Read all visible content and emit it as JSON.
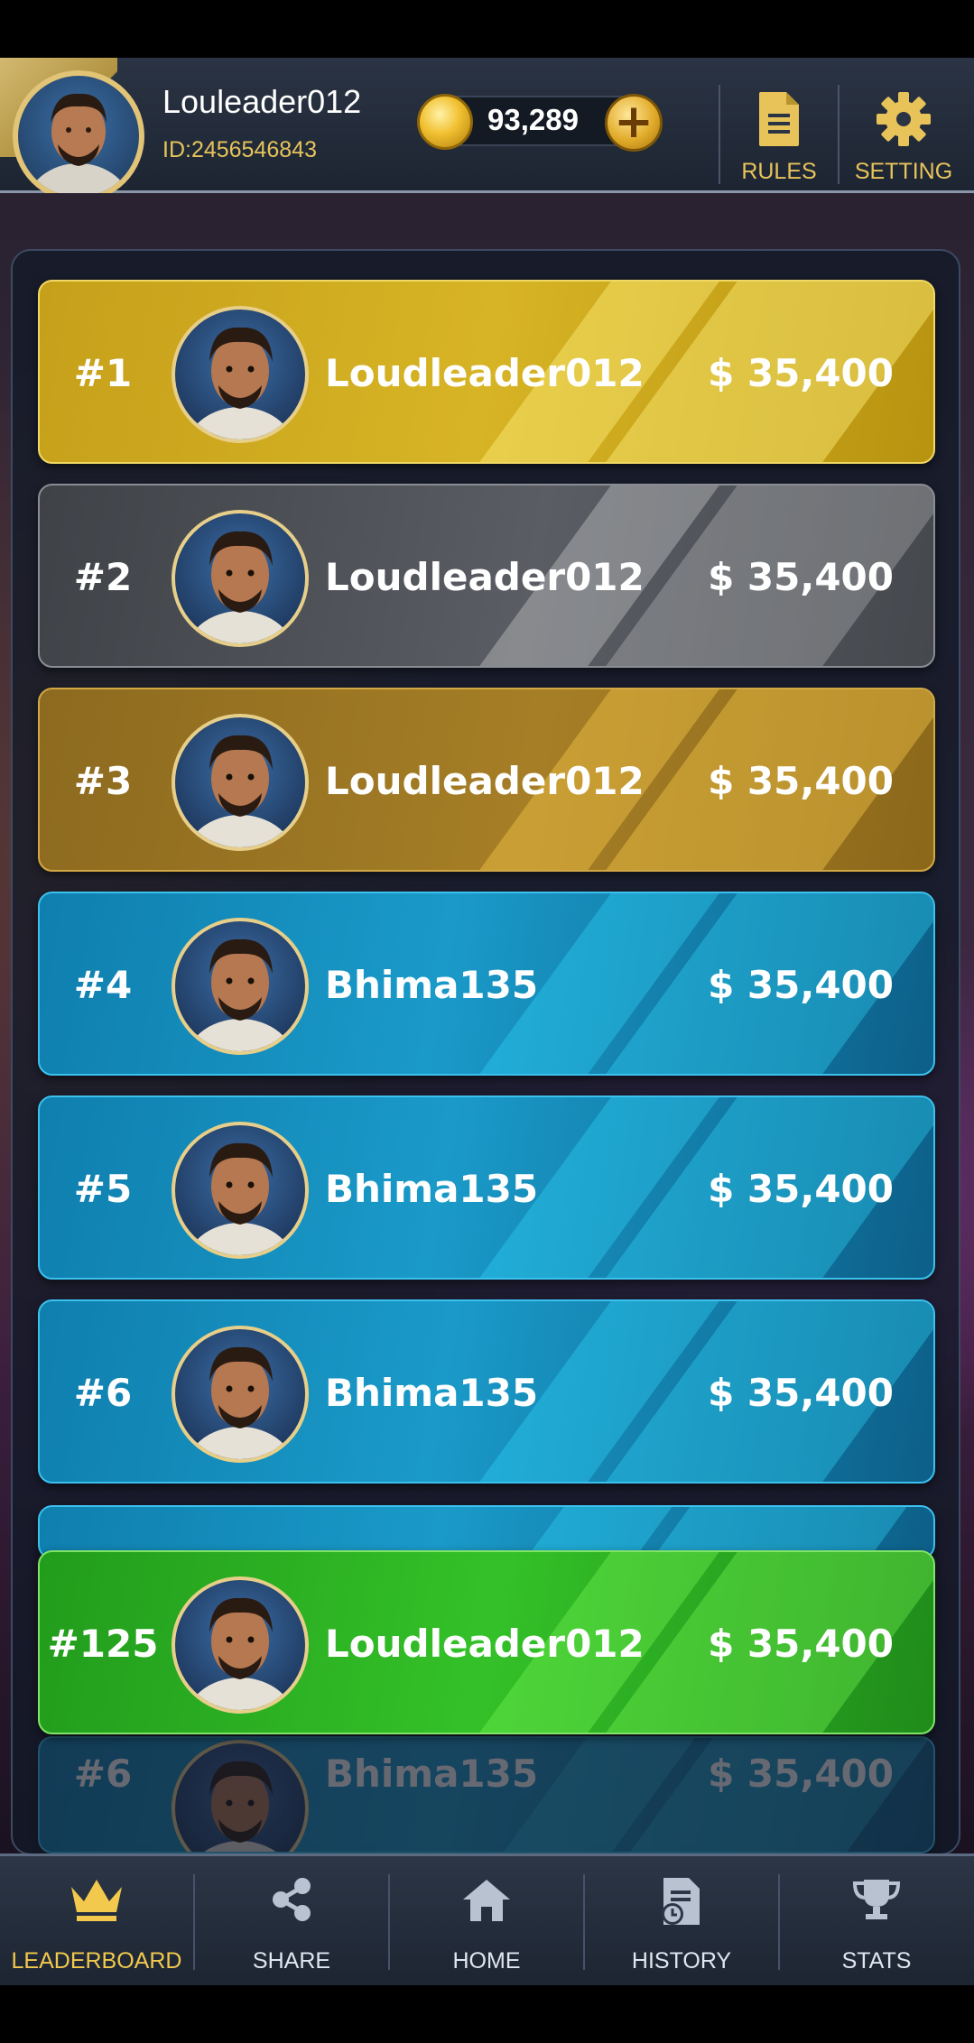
{
  "header": {
    "username": "Louleader012",
    "user_id": "ID:2456546843",
    "coins": "93,289",
    "add_coins_label": "+",
    "rules_label": "RULES",
    "setting_label": "SETTING"
  },
  "leaderboard": {
    "rows": [
      {
        "rank": "#1",
        "name": "Loudleader012",
        "amount": "$ 35,400",
        "tier": "gold"
      },
      {
        "rank": "#2",
        "name": "Loudleader012",
        "amount": "$ 35,400",
        "tier": "silver"
      },
      {
        "rank": "#3",
        "name": "Loudleader012",
        "amount": "$ 35,400",
        "tier": "bronze"
      },
      {
        "rank": "#4",
        "name": "Bhima135",
        "amount": "$ 35,400",
        "tier": "blue"
      },
      {
        "rank": "#5",
        "name": "Bhima135",
        "amount": "$ 35,400",
        "tier": "blue"
      },
      {
        "rank": "#6",
        "name": "Bhima135",
        "amount": "$ 35,400",
        "tier": "blue"
      }
    ],
    "current_user": {
      "rank": "#125",
      "name": "Loudleader012",
      "amount": "$ 35,400",
      "tier": "green"
    },
    "faded_row": {
      "rank": "#6",
      "name": "Bhima135",
      "amount": "$ 35,400",
      "tier": "blue"
    }
  },
  "nav": {
    "items": [
      {
        "label": "LEADERBOARD",
        "icon": "crown-icon",
        "active": true
      },
      {
        "label": "SHARE",
        "icon": "share-icon",
        "active": false
      },
      {
        "label": "HOME",
        "icon": "home-icon",
        "active": false
      },
      {
        "label": "HISTORY",
        "icon": "history-icon",
        "active": false
      },
      {
        "label": "STATS",
        "icon": "trophy-icon",
        "active": false
      }
    ]
  },
  "colors": {
    "gold_accent": "#e8c35a",
    "gold_row": "#d7b425",
    "silver_row": "#5a5d63",
    "bronze_row": "#a67e26",
    "blue_row": "#1a9ac9",
    "green_row": "#34c128"
  }
}
